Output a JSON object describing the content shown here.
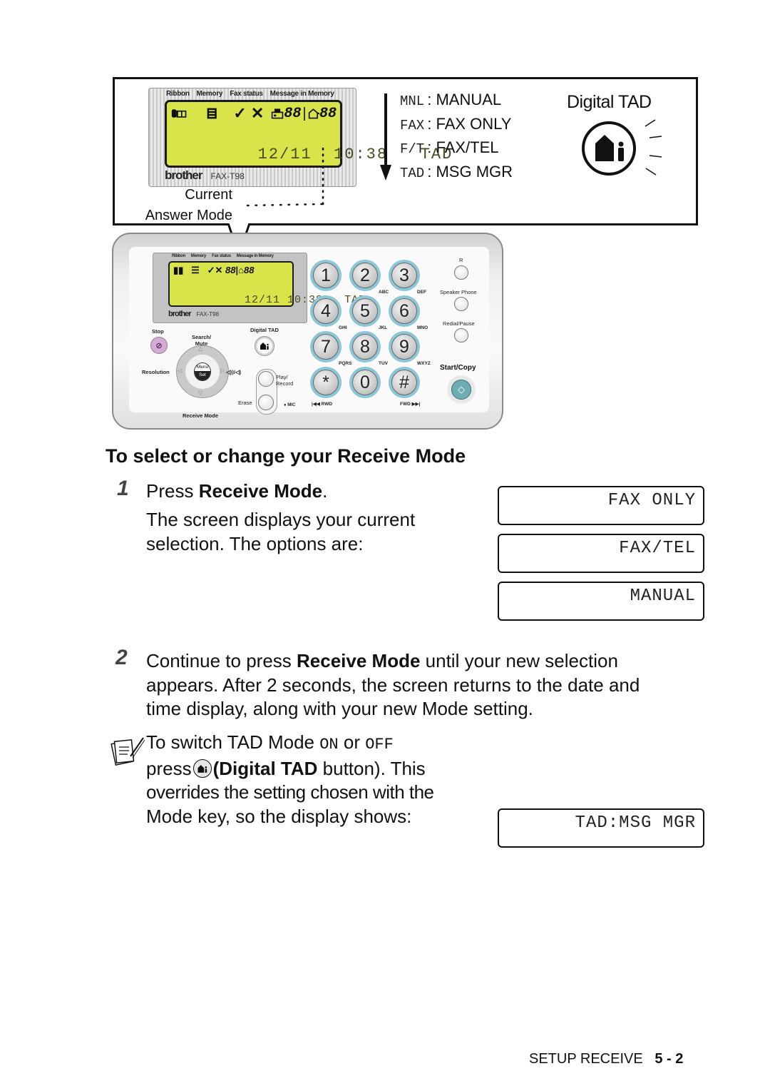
{
  "callout": {
    "lcd": {
      "labels": [
        "Ribbon",
        "Memory",
        "Fax status",
        "Message in Memory"
      ],
      "icon_row": [
        "ribbon-icon",
        "memory-icon",
        "check-icon",
        "cross-icon",
        "fax-counter-icon",
        "tad-counter-icon"
      ],
      "counter_value": "88",
      "date": "12/11",
      "time": "10:38",
      "mode": "TAD",
      "brand": "brother",
      "model": "FAX-T98"
    },
    "pointer_label_line1": "Current",
    "pointer_label_line2": "Answer Mode",
    "modes": [
      {
        "code": "MNL",
        "label": "MANUAL"
      },
      {
        "code": "FAX",
        "label": "FAX ONLY"
      },
      {
        "code": "F/T",
        "label": "FAX/TEL"
      },
      {
        "code": "TAD",
        "label": "MSG MGR"
      }
    ],
    "separator": ":",
    "digital_tad_title": "Digital TAD"
  },
  "phone": {
    "lcd": {
      "labels": [
        "Ribbon",
        "Memory",
        "Fax status",
        "Message in Memory"
      ],
      "date": "12/11",
      "time": "10:38",
      "mode": "TAD",
      "brand": "brother",
      "model": "FAX-T98"
    },
    "buttons": {
      "stop": "Stop",
      "search_mute": [
        "Search/",
        "Mute"
      ],
      "digital_tad": "Digital TAD",
      "resolution": "Resolution",
      "menu": "Menu",
      "set": "Set",
      "volume": "◁))/◁)",
      "play_record": [
        "Play/",
        "Record"
      ],
      "erase": "Erase",
      "mic": "● MIC",
      "receive_mode": "Receive Mode",
      "r": "R",
      "speaker_phone": "Speaker Phone",
      "redial_pause": "Redial/Pause",
      "start_copy": "Start/Copy"
    },
    "keypad": [
      {
        "key": "1",
        "sub": ""
      },
      {
        "key": "2",
        "sub": "ABC"
      },
      {
        "key": "3",
        "sub": "DEF"
      },
      {
        "key": "4",
        "sub": "GHI"
      },
      {
        "key": "5",
        "sub": "JKL"
      },
      {
        "key": "6",
        "sub": "MNO"
      },
      {
        "key": "7",
        "sub": "PQRS"
      },
      {
        "key": "8",
        "sub": "TUV"
      },
      {
        "key": "9",
        "sub": "WXYZ"
      },
      {
        "key": "*",
        "sub": "|◀◀ RWD"
      },
      {
        "key": "0",
        "sub": ""
      },
      {
        "key": "#",
        "sub": "FWD ▶▶|"
      }
    ]
  },
  "content": {
    "heading": "To select or change your Receive Mode",
    "step1": {
      "number": "1",
      "text_prefix": "Press ",
      "text_bold": "Receive Mode",
      "text_suffix": ".",
      "description_line1": "The screen displays your current",
      "description_line2": "selection. The options are:"
    },
    "lcd_options": [
      "FAX ONLY",
      "FAX/TEL",
      "MANUAL"
    ],
    "step2": {
      "number": "2",
      "line1_prefix": "Continue to press ",
      "line1_bold": "Receive Mode",
      "line1_suffix": " until your new selection",
      "line2": "appears. After 2 seconds, the screen returns to the date and",
      "line3": "time display, along with your new Mode setting."
    },
    "note": {
      "line1_prefix": "To switch TAD Mode ",
      "on": "ON",
      "or": " or ",
      "off": "OFF",
      "line2_prefix": "press",
      "line2_bold": "(Digital TAD",
      "line2_suffix": " button). This",
      "line3": "overrides the setting chosen with the",
      "line4": "Mode key, so the display shows:"
    },
    "tad_display": "TAD:MSG MGR"
  },
  "footer": {
    "section": "SETUP RECEIVE",
    "page": "5 - 2"
  }
}
